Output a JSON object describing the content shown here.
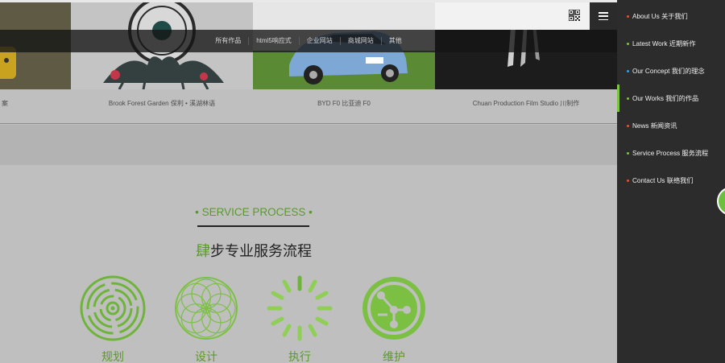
{
  "categories": [
    "所有作品",
    "html5响应式",
    "企业网站",
    "商城网站",
    "其他"
  ],
  "captions": [
    "案",
    "Brook Forest Garden 保利 • 溪湖林语",
    "BYD F0 比亚迪 F0",
    "Chuan Production Film Studio 川制作"
  ],
  "service": {
    "title_en": "• SERVICE PROCESS •",
    "title_cn_accent": "肆",
    "title_cn_rest": "步专业服务流程",
    "steps": [
      "规划",
      "设计",
      "执行",
      "维护"
    ]
  },
  "side_menu": [
    {
      "label": "About Us 关于我们",
      "dot_color": "#e0533a"
    },
    {
      "label": "Latest Work 近期新作",
      "dot_color": "#3aa0e0"
    },
    {
      "label": "Our Concept 我们的理念",
      "dot_color": "#3aa0e0"
    },
    {
      "label": "Our Works 我们的作品",
      "dot_color": "#7ec43e"
    },
    {
      "label": "News 新闻资讯",
      "dot_color": "#e0533a"
    },
    {
      "label": "Service Process 服务流程",
      "dot_color": "#7ec43e"
    },
    {
      "label": "Contact Us 联络我们",
      "dot_color": "#e0533a"
    }
  ],
  "colors": {
    "accent": "#5a9a2a",
    "menu_bg": "#2c2c2c"
  },
  "icons": {
    "qr": "qr-code-icon",
    "menu": "hamburger-menu-icon"
  }
}
